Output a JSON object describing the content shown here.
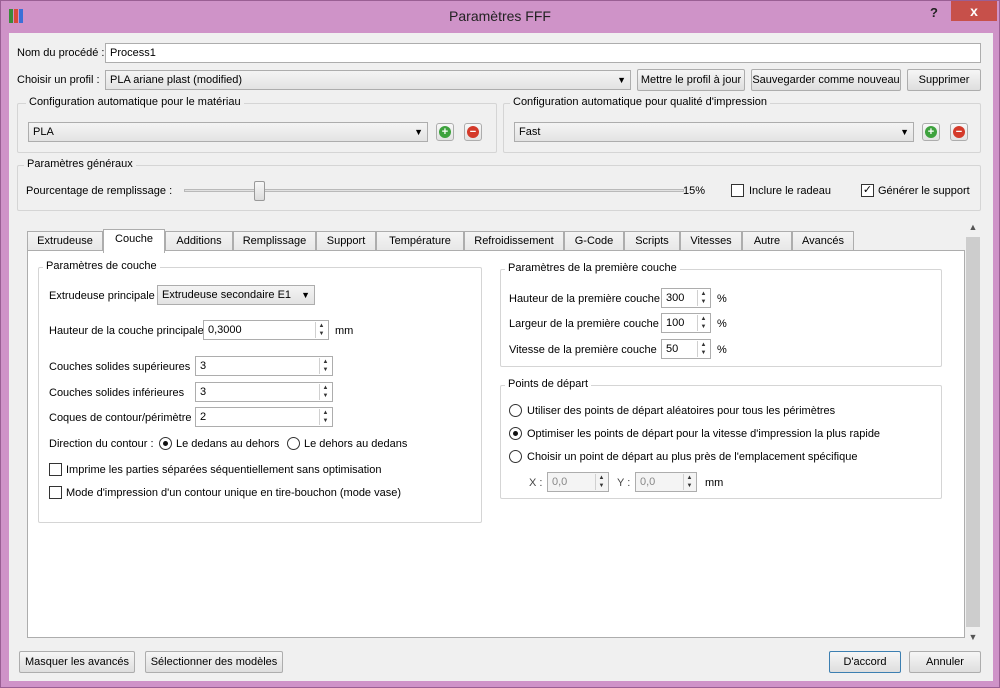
{
  "window": {
    "title": "Paramètres FFF",
    "help": "?",
    "close": "x"
  },
  "process": {
    "name_label": "Nom du procédé :",
    "name_value": "Process1"
  },
  "profile": {
    "label": "Choisir un profil :",
    "value": "PLA ariane plast (modified)",
    "update_btn": "Mettre le profil à jour",
    "save_new_btn": "Sauvegarder comme nouveau",
    "delete_btn": "Supprimer"
  },
  "auto_material": {
    "title": "Configuration automatique pour le matériau",
    "value": "PLA"
  },
  "auto_quality": {
    "title": "Configuration automatique pour qualité d'impression",
    "value": "Fast"
  },
  "general": {
    "title": "Paramètres généraux",
    "infill_label": "Pourcentage de remplissage :",
    "infill_value": "15%",
    "infill_fraction": 0.15,
    "raft_label": "Inclure le radeau",
    "raft_checked": false,
    "support_label": "Générer le support",
    "support_checked": true
  },
  "tabs": [
    "Extrudeuse",
    "Couche",
    "Additions",
    "Remplissage",
    "Support",
    "Température",
    "Refroidissement",
    "G-Code",
    "Scripts",
    "Vitesses",
    "Autre",
    "Avancés"
  ],
  "active_tab": "Couche",
  "layer": {
    "title": "Paramètres de couche",
    "main_extruder_label": "Extrudeuse principale",
    "main_extruder_value": "Extrudeuse secondaire E1",
    "layer_height_label": "Hauteur de la couche principale",
    "layer_height_value": "0,3000",
    "layer_height_unit": "mm",
    "top_solid_label": "Couches solides supérieures",
    "top_solid_value": "3",
    "bottom_solid_label": "Couches solides inférieures",
    "bottom_solid_value": "3",
    "perimeter_label": "Coques de contour/périmètre",
    "perimeter_value": "2",
    "direction_label": "Direction du contour :",
    "direction_inside_out": "Le dedans au dehors",
    "direction_outside_in": "Le dehors au dedans",
    "sequential_label": "Imprime les parties séparées séquentiellement sans optimisation",
    "vase_label": "Mode d'impression d'un contour unique en tire-bouchon (mode vase)"
  },
  "first_layer": {
    "title": "Paramètres de la première couche",
    "height_label": "Hauteur de la première couche",
    "height_value": "300",
    "width_label": "Largeur de la première couche",
    "width_value": "100",
    "speed_label": "Vitesse de la première couche",
    "speed_value": "50",
    "unit": "%"
  },
  "start_points": {
    "title": "Points de départ",
    "opt_random": "Utiliser des points de départ aléatoires pour tous les périmètres",
    "opt_optimize": "Optimiser les points de départ pour la vitesse d'impression la plus rapide",
    "opt_specific": "Choisir un point de départ au plus près de l'emplacement spécifique",
    "x_label": "X :",
    "x_value": "0,0",
    "y_label": "Y :",
    "y_value": "0,0",
    "unit": "mm"
  },
  "footer": {
    "hide_advanced": "Masquer les avancés",
    "select_models": "Sélectionner des modèles",
    "ok": "D'accord",
    "cancel": "Annuler"
  }
}
